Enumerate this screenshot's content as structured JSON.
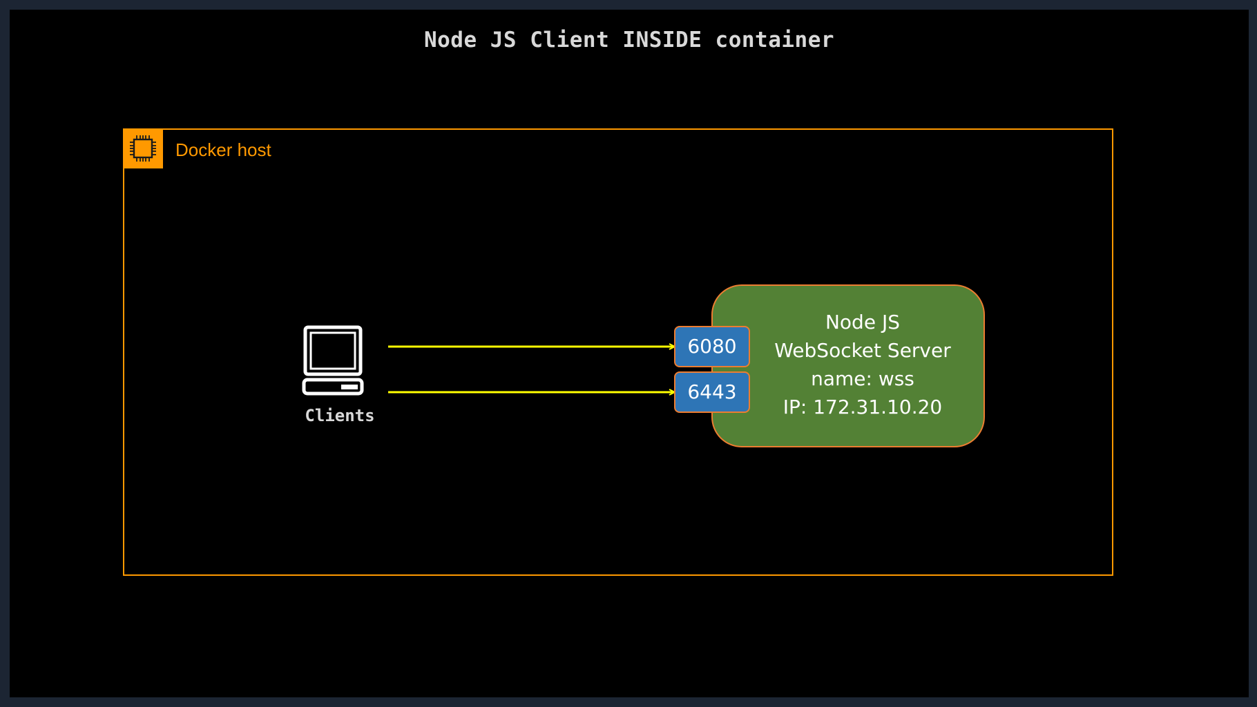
{
  "title": "Node JS Client INSIDE container",
  "host": {
    "label": "Docker host",
    "icon": "chip-icon",
    "color": "#ff9900"
  },
  "client": {
    "label": "Clients",
    "icon": "laptop-icon"
  },
  "server": {
    "lines": [
      "Node JS",
      "WebSocket Server",
      "name: wss",
      "IP: 172.31.10.20"
    ],
    "fill": "#538135",
    "border": "#ed7d31"
  },
  "ports": [
    {
      "label": "6080"
    },
    {
      "label": "6443"
    }
  ],
  "arrow_color": "#ffff00",
  "port_fill": "#2e75b6"
}
